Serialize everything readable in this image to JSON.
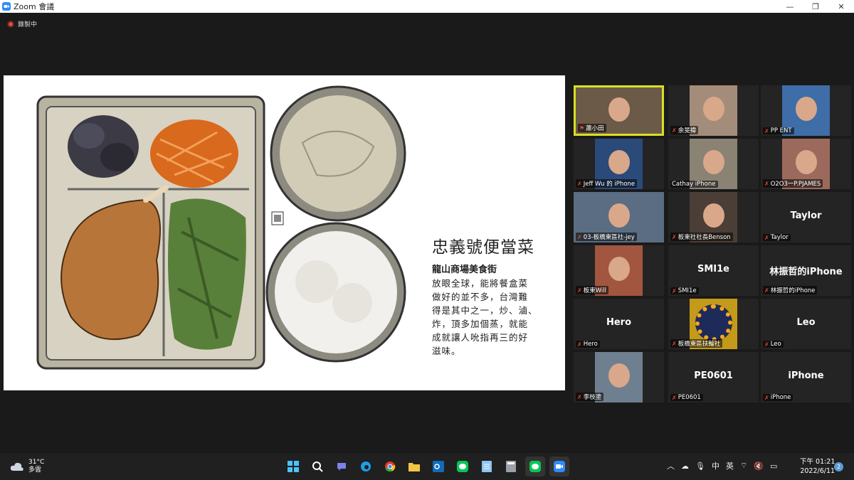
{
  "window": {
    "title": "Zoom 會議",
    "minimize": "—",
    "maximize": "❐",
    "close": "✕"
  },
  "recording": {
    "label": "錄製中"
  },
  "slide": {
    "title": "忠義號便當菜",
    "subtitle": "龍山商場美食街",
    "body": [
      "放眼全球，能將餐盒菜",
      "做好的並不多，台灣難",
      "得是其中之一，炒、滷、",
      "炸，頂多加個蒸，就能",
      "成就讓人吮指再三的好",
      "滋味。"
    ]
  },
  "participants": [
    {
      "label": "蕭小田",
      "video": true,
      "active": true,
      "muted": false
    },
    {
      "label": "余旻禕",
      "video": true,
      "muted": true
    },
    {
      "label": "PP ENT",
      "video": true,
      "muted": true
    },
    {
      "label": "Jeff Wu 的 iPhone",
      "video": true,
      "muted": true
    },
    {
      "label": "Cathay iPhone",
      "video": true,
      "muted": false
    },
    {
      "label": "O2O3一P.PJAMES",
      "video": true,
      "muted": true
    },
    {
      "label": "03-板橋東區社-jey",
      "video": true,
      "muted": true
    },
    {
      "label": "板東社社長Benson",
      "video": true,
      "muted": true
    },
    {
      "label": "Taylor",
      "video": false,
      "big": "Taylor",
      "muted": true
    },
    {
      "label": "板東Will",
      "video": true,
      "muted": true
    },
    {
      "label": "SMI1e",
      "video": false,
      "big": "SMI1e",
      "muted": true
    },
    {
      "label": "林振哲的iPhone",
      "video": false,
      "big": "林振哲的iPhone",
      "muted": true
    },
    {
      "label": "Hero",
      "video": false,
      "big": "Hero",
      "muted": true
    },
    {
      "label": "板橋東區扶輪社",
      "video": true,
      "muted": true
    },
    {
      "label": "Leo",
      "video": false,
      "big": "Leo",
      "muted": true
    },
    {
      "label": "李枝塗",
      "video": true,
      "muted": true
    },
    {
      "label": "PE0601",
      "video": false,
      "big": "PE0601",
      "muted": true
    },
    {
      "label": "iPhone",
      "video": false,
      "big": "iPhone",
      "muted": true
    }
  ],
  "taskbar": {
    "weather_temp": "31°C",
    "weather_desc": "多雲",
    "time": "下午 01:21",
    "date": "2022/6/11",
    "notifications": "2",
    "ime": "中",
    "ime2": "英"
  }
}
